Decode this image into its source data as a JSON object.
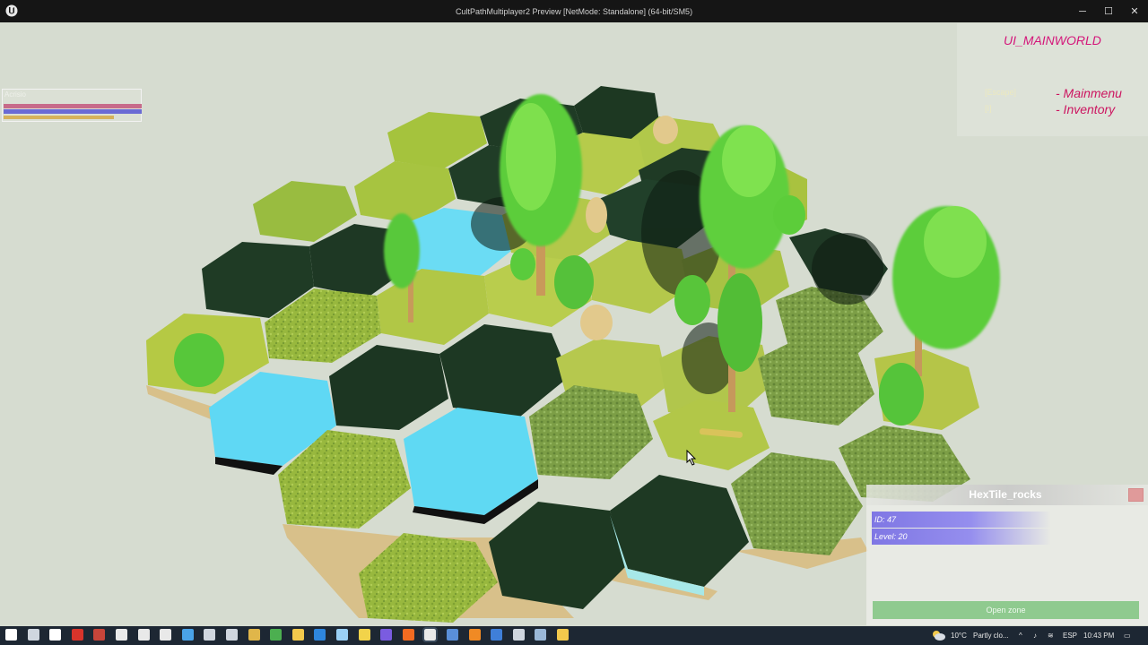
{
  "window": {
    "title": "CultPathMultiplayer2 Preview [NetMode: Standalone]  (64-bit/SM5)",
    "minimize_glyph": "─",
    "maximize_glyph": "☐",
    "close_glyph": "✕"
  },
  "player": {
    "name": "Acrisio",
    "health_fraction": 1.0,
    "mana_fraction": 1.0,
    "stamina_fraction": 0.8
  },
  "debug_panel": {
    "widget_name": "UI_MAINWORLD",
    "hint_line_1": "[Escape]",
    "hint_line_2": "[I]",
    "menu_items": [
      "- Mainmenu",
      "- Inventory"
    ]
  },
  "tile_panel": {
    "title": "HexTile_rocks",
    "id_label": "ID: 47",
    "level_label": "Level: 20",
    "open_button": "Open zone"
  },
  "taskbar": {
    "weather_temp": "10°C",
    "weather_text": "Partly clo...",
    "language": "ESP",
    "clock": "10:43 PM",
    "icons": [
      "windows-start-icon",
      "search-icon",
      "task-view-icon",
      "app-red-icon",
      "app-red2-icon",
      "unreal-icon",
      "unreal2-icon",
      "unreal3-icon",
      "monitor-icon",
      "code-icon",
      "terminal-icon",
      "chrome-icon",
      "chrome2-icon",
      "chrome3-icon",
      "edge-icon",
      "notes-icon",
      "sticky-note-icon",
      "app-purple-icon",
      "brave-icon",
      "unreal-active-icon",
      "mail-icon",
      "blender-icon",
      "app-blue-icon",
      "github-icon",
      "steam-icon",
      "folder-icon"
    ]
  },
  "colors": {
    "grass": "#a9c43a",
    "forest": "#1e3a24",
    "water": "#62dcf6",
    "tile_side": "#d8c08a",
    "tree": "#5fd33b",
    "menu_pink": "#d4167a",
    "stat_purple": "#857ee6",
    "open_green": "#8fca8f"
  },
  "cursor": "arrow-cursor"
}
